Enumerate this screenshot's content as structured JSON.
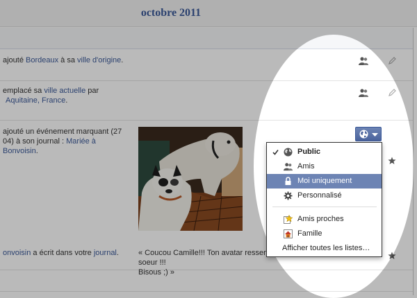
{
  "timeline": {
    "month_title": "octobre 2011"
  },
  "rows": [
    {
      "pre": "ajouté ",
      "link1": "Bordeaux",
      "mid": " à sa ",
      "link2": "ville d'origine",
      "post": "."
    },
    {
      "line1_pre": "emplacé sa ",
      "line1_link": "ville actuelle",
      "line1_post": " par",
      "line2_link": "Aquitaine, France",
      "line2_post": "."
    },
    {
      "line1": "ajouté un événement marquant (27",
      "line2_pre": "04) à son journal : ",
      "line2_link": "Mariée à",
      "line3_link": "Bonvoisin",
      "line3_post": "."
    },
    {
      "left_link": "onvoisin",
      "left_mid": " a écrit dans votre ",
      "left_link2": "journal",
      "left_post": ".",
      "quote_line1": "« Coucou Camille!!! Ton avatar ressem",
      "quote_line2": "soeur !!!",
      "quote_line3": "Bisous ;) »"
    }
  ],
  "privacy_menu": {
    "items": [
      {
        "label": "Public",
        "icon": "globe-icon",
        "checked": true
      },
      {
        "label": "Amis",
        "icon": "friends-icon"
      },
      {
        "label": "Moi uniquement",
        "icon": "lock-icon",
        "selected": true
      },
      {
        "label": "Personnalisé",
        "icon": "gear-icon"
      }
    ],
    "lists": [
      {
        "label": "Amis proches",
        "icon": "star-list-icon"
      },
      {
        "label": "Famille",
        "icon": "house-icon"
      }
    ],
    "show_all": "Afficher toutes les listes…"
  },
  "colors": {
    "brand": "#3b5998",
    "selected_bg": "#6d84b4"
  }
}
